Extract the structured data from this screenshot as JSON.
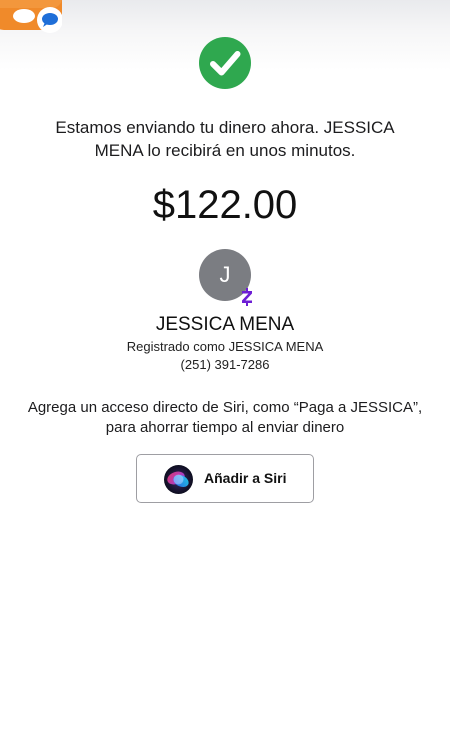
{
  "header": {
    "app_icon": "messages-app-icon"
  },
  "status": {
    "icon": "check-circle-icon",
    "color": "#2fa84f"
  },
  "message": "Estamos enviando tu dinero ahora. JESSICA MENA lo recibirá en unos minutos.",
  "amount": "$122.00",
  "recipient": {
    "initial": "J",
    "name": "JESSICA MENA",
    "registered_as": "Registrado como JESSICA MENA",
    "phone": "(251) 391-7286",
    "badge_icon": "zelle-icon",
    "badge_color": "#6d1ed4"
  },
  "siri": {
    "description": "Agrega un acceso directo de Siri, como “Paga a JESSICA”, para ahorrar tiempo al enviar dinero",
    "button_label": "Añadir a Siri",
    "icon": "siri-icon"
  }
}
